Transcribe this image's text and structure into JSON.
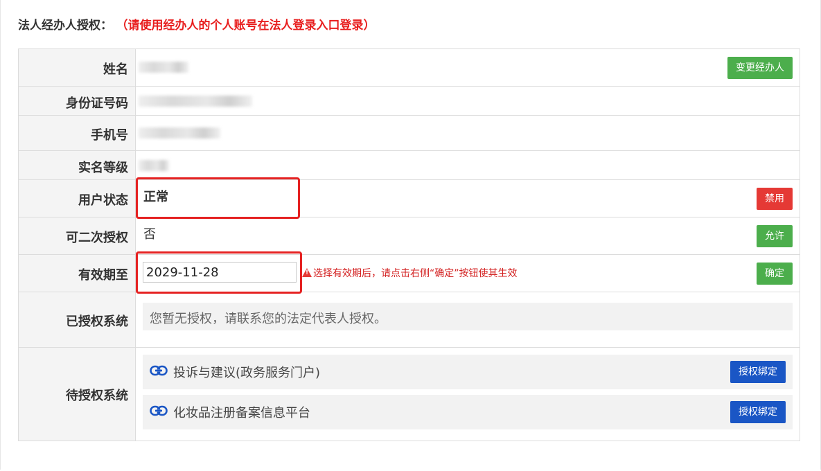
{
  "header": {
    "title": "法人经办人授权：",
    "note": "（请使用经办人的个人账号在法人登录入口登录）"
  },
  "rows": {
    "name": {
      "label": "姓名"
    },
    "id_number": {
      "label": "身份证号码"
    },
    "phone": {
      "label": "手机号"
    },
    "verify_level": {
      "label": "实名等级"
    },
    "user_status": {
      "label": "用户状态",
      "value": "正常"
    },
    "secondary_auth": {
      "label": "可二次授权",
      "value": "否"
    },
    "valid_until": {
      "label": "有效期至",
      "value": "2029-11-28"
    },
    "authorized_systems": {
      "label": "已授权系统",
      "empty_text": "您暂无授权，请联系您的法定代表人授权。"
    },
    "pending_systems": {
      "label": "待授权系统",
      "items": [
        {
          "name": "投诉与建议(政务服务门户)",
          "button": "授权绑定"
        },
        {
          "name": "化妆品注册备案信息平台",
          "button": "授权绑定"
        }
      ]
    }
  },
  "buttons": {
    "change_handler": "变更经办人",
    "disable": "禁用",
    "allow": "允许",
    "confirm": "确定"
  },
  "warning": "选择有效期后，请点击右侧“确定”按钮使其生效",
  "icons": {
    "warning": "warning-triangle-icon",
    "link": "link-icon"
  },
  "colors": {
    "header_note": "#e81e1e",
    "green_button": "#4cae4c",
    "red_button": "#e53935",
    "blue_button": "#1a56c5",
    "highlight_box": "#e52222"
  }
}
